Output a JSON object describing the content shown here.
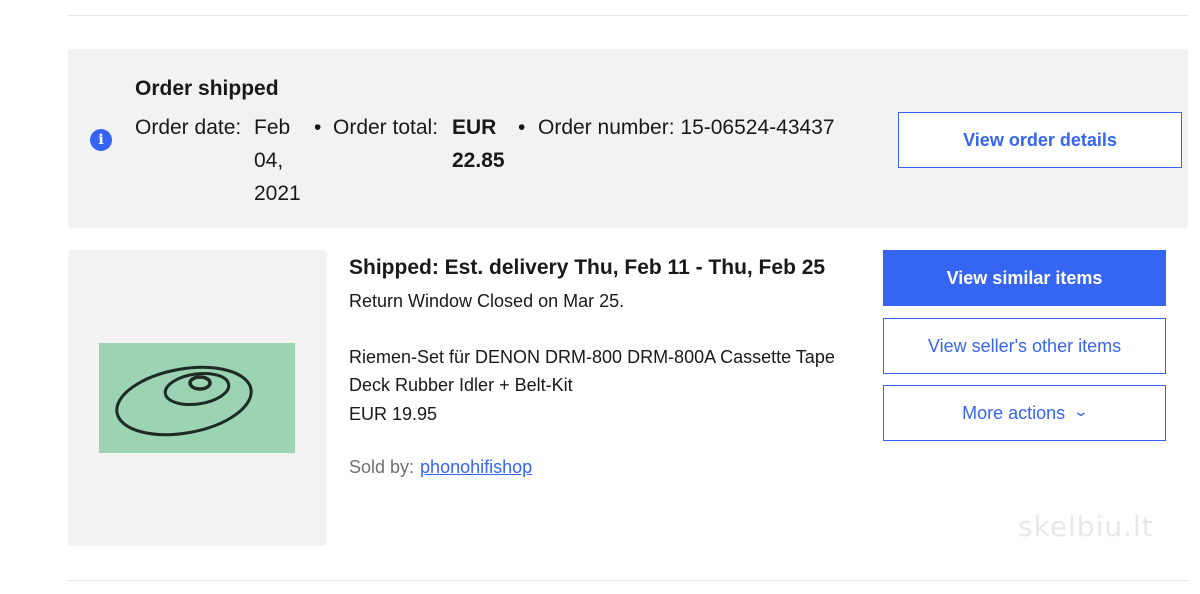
{
  "order": {
    "status_title": "Order shipped",
    "date_label": "Order date:",
    "date_value": "Feb 04, 2021",
    "total_label": "Order total:",
    "total_value": "EUR 22.85",
    "number_label": "Order number:",
    "number_value": "15-06524-43437",
    "bullet": "•",
    "view_details_label": "View order details",
    "info_icon": "i"
  },
  "item": {
    "status_line": "Shipped: Est. delivery Thu, Feb 11 - Thu, Feb 25",
    "return_window": "Return Window Closed on Mar 25.",
    "title": "Riemen-Set für DENON DRM-800 DRM-800A Cassette Tape Deck Rubber Idler + Belt-Kit",
    "price": "EUR 19.95",
    "sold_by_label": "Sold by:",
    "seller": "phonohifishop"
  },
  "actions": {
    "similar": "View similar items",
    "seller_items": "View seller's other items",
    "more": "More actions",
    "more_icon": "chevron-down-icon"
  },
  "watermark": "skelbiu.lt",
  "colors": {
    "accent": "#3665f3",
    "banner_bg": "#f2f2f2",
    "thumb_bg": "#9bd3b3"
  }
}
